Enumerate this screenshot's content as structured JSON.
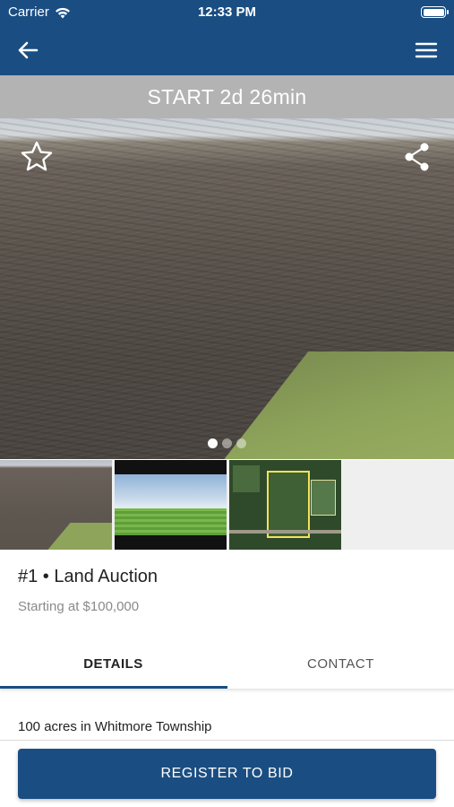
{
  "status_bar": {
    "carrier": "Carrier",
    "time": "12:33 PM"
  },
  "nav": {
    "back_icon": "arrow-left-icon",
    "menu_icon": "hamburger-menu-icon"
  },
  "timer": {
    "label": "START 2d 26min"
  },
  "gallery": {
    "favorite_icon": "star-outline-icon",
    "share_icon": "share-icon",
    "page_count": 3,
    "active_page": 0,
    "thumbnails": [
      "plowed-field-photo",
      "crop-field-photo",
      "aerial-map-photo"
    ]
  },
  "listing": {
    "title": "#1 • Land Auction",
    "starting_price": "Starting at $100,000"
  },
  "tabs": [
    {
      "label": "DETAILS",
      "active": true
    },
    {
      "label": "CONTACT",
      "active": false
    }
  ],
  "details": {
    "description": "100 acres in Whitmore Township"
  },
  "footer": {
    "register_label": "REGISTER TO BID"
  },
  "colors": {
    "primary": "#1a4e82",
    "timer_bg": "#b3b3b3"
  }
}
